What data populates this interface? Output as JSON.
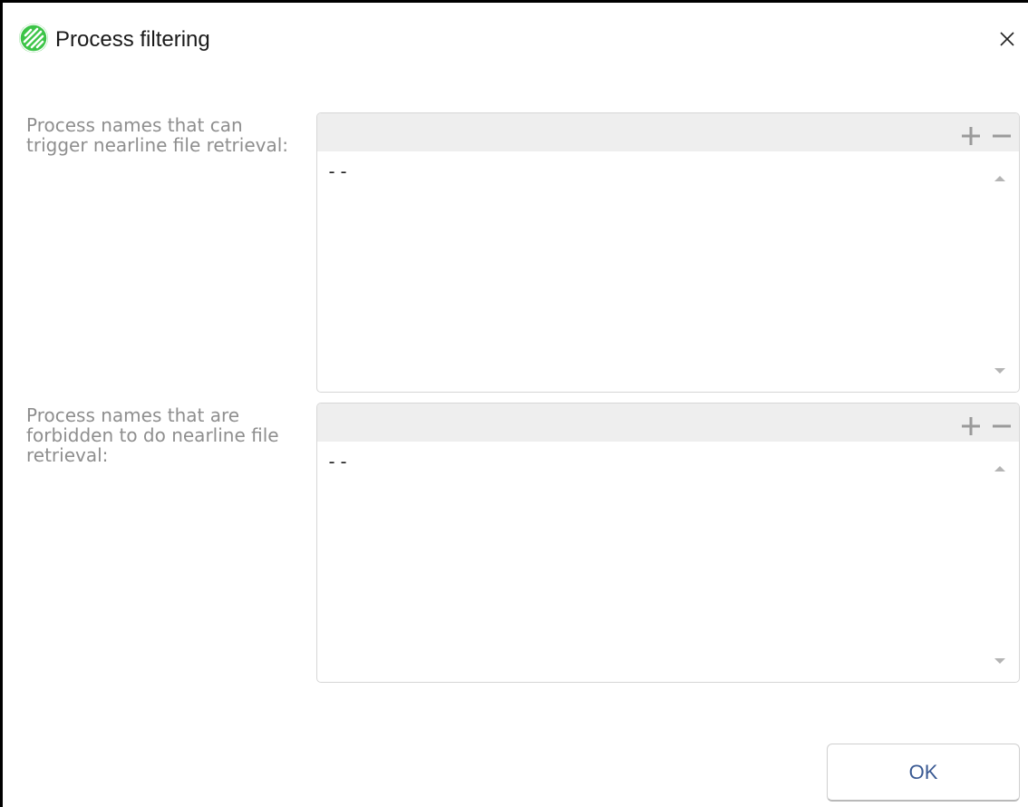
{
  "window": {
    "title": "Process filtering",
    "logo_icon": "app-logo-icon",
    "close_icon": "close-icon"
  },
  "lists": [
    {
      "label": "Process names that can trigger nearline file retrieval:",
      "items": [
        "--"
      ],
      "add_icon": "plus-icon",
      "remove_icon": "minus-icon"
    },
    {
      "label": "Process names that are forbidden to do nearline file retrieval:",
      "items": [
        "--"
      ],
      "add_icon": "plus-icon",
      "remove_icon": "minus-icon"
    }
  ],
  "footer": {
    "ok_label": "OK"
  },
  "colors": {
    "brand": "#3cc447",
    "label_text": "#8e8e8e",
    "toolbar_bg": "#eeeeee",
    "button_text": "#3a5a93"
  }
}
